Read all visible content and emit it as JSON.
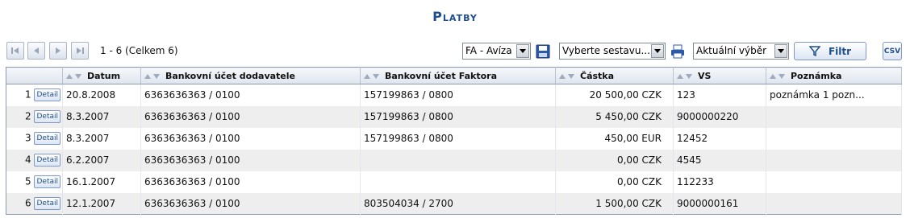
{
  "page": {
    "title": "Platby"
  },
  "pager": {
    "info": "1 - 6 (Celkem 6)"
  },
  "toolbar": {
    "view_select": "FA - Avíza",
    "report_select": "Vyberte sestavu...",
    "selection_select": "Aktuální výběr",
    "filter_label": "Filtr",
    "csv_label": "CSV"
  },
  "grid": {
    "columns": [
      "Datum",
      "Bankovní účet dodavatele",
      "Bankovní účet Faktora",
      "Částka",
      "VS",
      "Poznámka"
    ],
    "detail_label": "Detail",
    "rows": [
      {
        "num": "1",
        "datum": "20.8.2008",
        "ucet_dod": "6363636363 / 0100",
        "ucet_fak": "157199863 / 0800",
        "castka": "20 500,00 CZK",
        "vs": "123",
        "poznamka": "poznámka 1 pozn..."
      },
      {
        "num": "2",
        "datum": "8.3.2007",
        "ucet_dod": "6363636363 / 0100",
        "ucet_fak": "157199863 / 0800",
        "castka": "5 450,00 CZK",
        "vs": "9000000220",
        "poznamka": ""
      },
      {
        "num": "3",
        "datum": "8.3.2007",
        "ucet_dod": "6363636363 / 0100",
        "ucet_fak": "157199863 / 0800",
        "castka": "450,00 EUR",
        "vs": "12452",
        "poznamka": ""
      },
      {
        "num": "4",
        "datum": "6.2.2007",
        "ucet_dod": "6363636363 / 0100",
        "ucet_fak": "",
        "castka": "0,00 CZK",
        "vs": "4545",
        "poznamka": ""
      },
      {
        "num": "5",
        "datum": "16.1.2007",
        "ucet_dod": "6363636363 / 0100",
        "ucet_fak": "",
        "castka": "0,00 CZK",
        "vs": "112233",
        "poznamka": ""
      },
      {
        "num": "6",
        "datum": "12.1.2007",
        "ucet_dod": "6363636363 / 0100",
        "ucet_fak": "803504034 / 2700",
        "castka": "1 500,00 CZK",
        "vs": "9000000161",
        "poznamka": ""
      }
    ]
  }
}
